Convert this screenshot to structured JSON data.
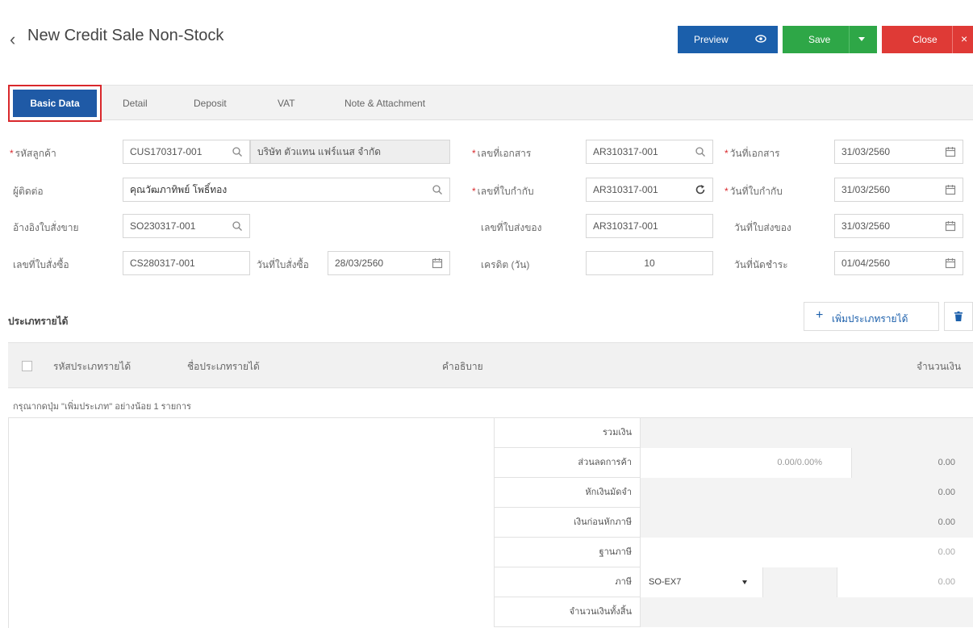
{
  "header": {
    "back_icon": "chevron-left-icon",
    "title": "New Credit Sale Non-Stock",
    "preview_label": "Preview",
    "save_label": "Save",
    "close_label": "Close",
    "colors": {
      "preview": "#1b5fab",
      "save": "#2ea747",
      "close": "#df3a36"
    }
  },
  "tabs": [
    "Basic Data",
    "Detail",
    "Deposit",
    "VAT",
    "Note & Attachment"
  ],
  "form": {
    "customer_code_label": "รหัสลูกค้า",
    "customer_code": "CUS170317-001",
    "customer_name": "บริษัท ตัวแทน แฟร์แนส จำกัด",
    "contact_label": "ผู้ติดต่อ",
    "contact": "คุณวัฒภาทิพย์ โพธิ์ทอง",
    "so_ref_label": "อ้างอิงใบสั่งขาย",
    "so_ref": "SO230317-001",
    "po_no_label": "เลขที่ใบสั่งซื้อ",
    "po_no": "CS280317-001",
    "po_date_label": "วันที่ใบสั่งซื้อ",
    "po_date": "28/03/2560",
    "doc_no_label": "เลขที่เอกสาร",
    "doc_no": "AR310317-001",
    "tax_inv_no_label": "เลขที่ใบกำกับ",
    "tax_inv_no": "AR310317-001",
    "delivery_no_label": "เลขที่ใบส่งของ",
    "delivery_no": "AR310317-001",
    "credit_label": "เครดิต (วัน)",
    "credit": "10",
    "doc_date_label": "วันที่เอกสาร",
    "doc_date": "31/03/2560",
    "tax_inv_date_label": "วันที่ใบกำกับ",
    "tax_inv_date": "31/03/2560",
    "delivery_date_label": "วันที่ใบส่งของ",
    "delivery_date": "31/03/2560",
    "due_date_label": "วันที่นัดชำระ",
    "due_date": "01/04/2560"
  },
  "income": {
    "section_title": "ประเภทรายได้",
    "add_label": "เพิ่มประเภทรายได้",
    "columns": [
      "รหัสประเภทรายได้",
      "ชื่อประเภทรายได้",
      "คำอธิบาย",
      "จำนวนเงิน"
    ],
    "hint": "กรุณากดปุ่ม \"เพิ่มประเภท\" อย่างน้อย 1 รายการ"
  },
  "summary": {
    "total_label": "รวมเงิน",
    "discount_label": "ส่วนลดการค้า",
    "discount_pct": "0.00/0.00%",
    "discount_value": "0.00",
    "deposit_label": "หักเงินมัดจำ",
    "deposit_value": "0.00",
    "pretax_label": "เงินก่อนหักภาษี",
    "pretax_value": "0.00",
    "taxbase_label": "ฐานภาษี",
    "taxbase_value": "0.00",
    "tax_label": "ภาษี",
    "tax_code": "SO-EX7",
    "tax_value": "0.00",
    "grand_label": "จำนวนเงินทั้งสิ้น"
  }
}
